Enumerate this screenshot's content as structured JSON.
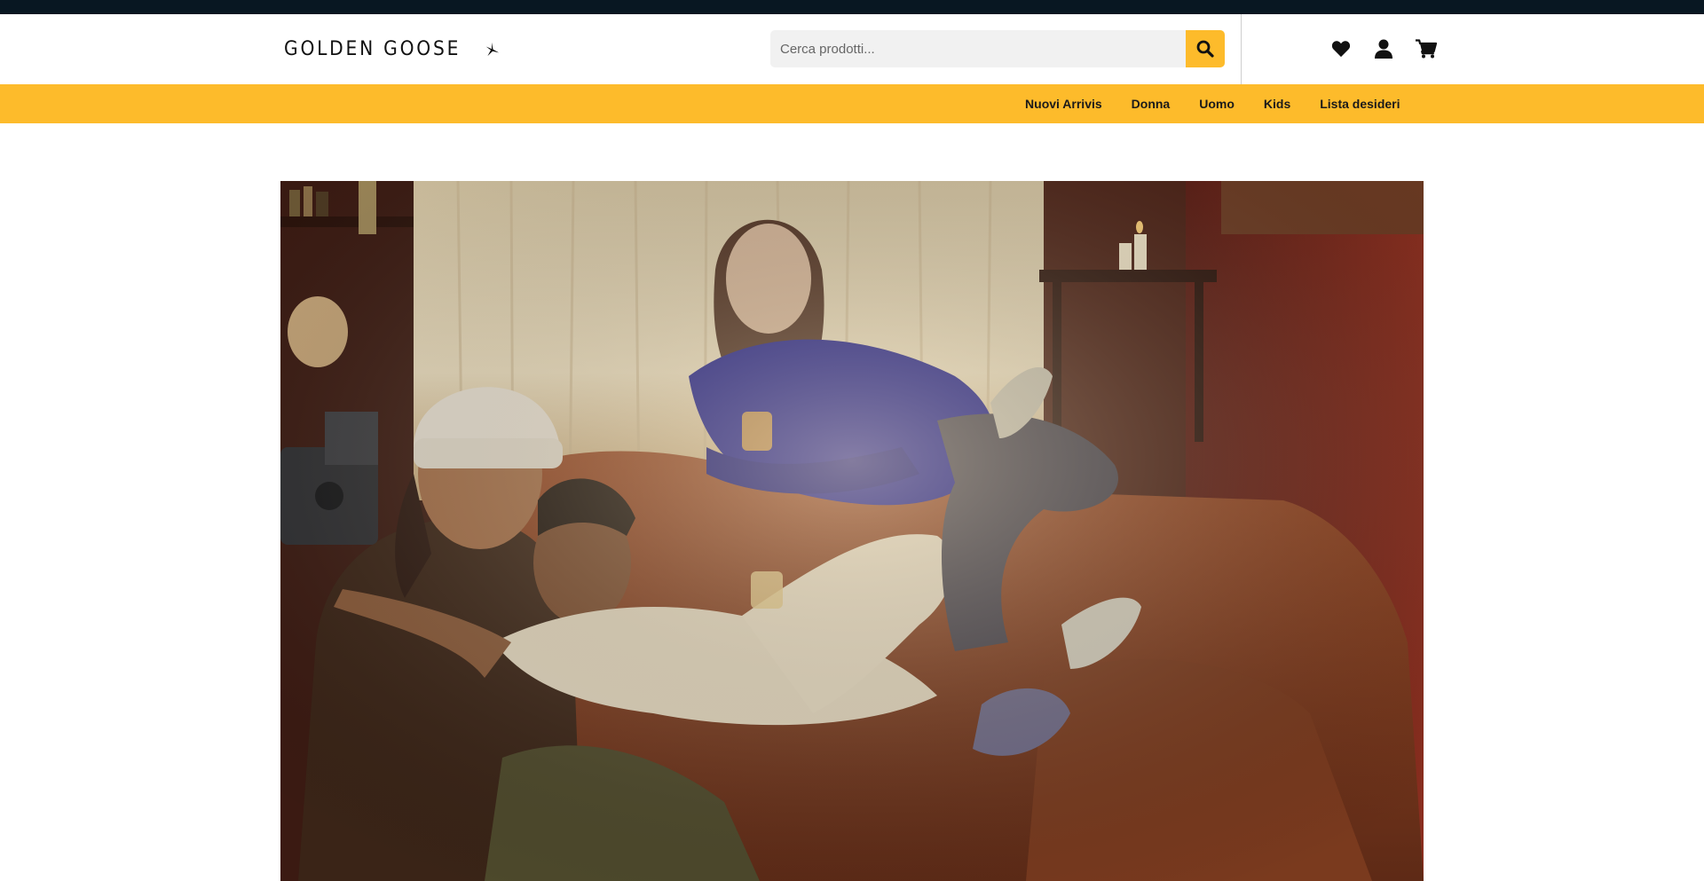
{
  "header": {
    "logo": {
      "text": "GOLDEN GOOSE"
    },
    "search": {
      "placeholder": "Cerca prodotti..."
    },
    "icons": [
      "heart-icon",
      "user-icon",
      "cart-icon",
      "search-icon",
      "star-icon"
    ]
  },
  "nav": {
    "items": [
      {
        "label": "Nuovi Arrivis"
      },
      {
        "label": "Donna"
      },
      {
        "label": "Uomo"
      },
      {
        "label": "Kids"
      },
      {
        "label": "Lista desideri"
      }
    ]
  },
  "colors": {
    "accent": "#fdbb2b",
    "topbar": "#081722",
    "text": "#1a1a1a",
    "search_bg": "#f1f1f1"
  }
}
